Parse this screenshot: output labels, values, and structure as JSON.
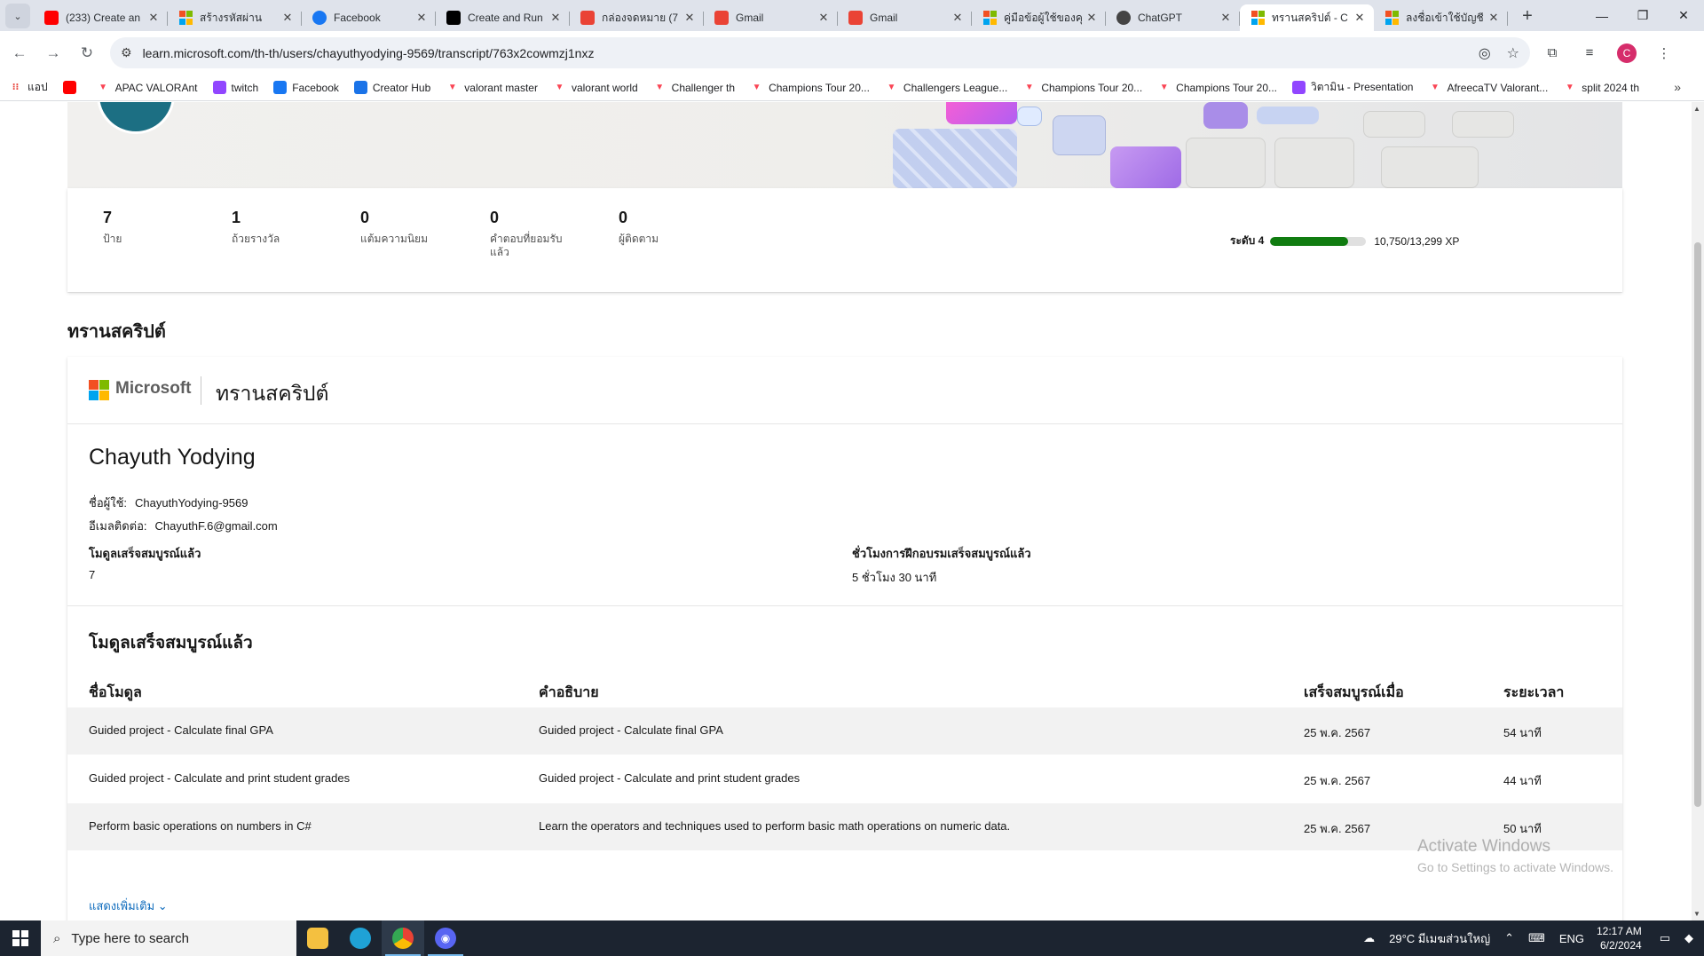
{
  "browser": {
    "tabs": [
      {
        "title": "(233) Create an",
        "icon": "youtube-icon",
        "color": "#ff0000"
      },
      {
        "title": "สร้างรหัสผ่าน",
        "icon": "microsoft-icon",
        "color": "#f25022"
      },
      {
        "title": "Facebook",
        "icon": "facebook-icon",
        "color": "#1877f2"
      },
      {
        "title": "Create and Run",
        "icon": "app-icon",
        "color": "#000000"
      },
      {
        "title": "กล่องจดหมาย (7",
        "icon": "gmail-icon",
        "color": "#ea4335"
      },
      {
        "title": "Gmail",
        "icon": "gmail-icon",
        "color": "#ea4335"
      },
      {
        "title": "Gmail",
        "icon": "gmail-icon",
        "color": "#ea4335"
      },
      {
        "title": "คู่มือข้อผู้ใช้ของคุ",
        "icon": "microsoft-icon",
        "color": "#f25022"
      },
      {
        "title": "ChatGPT",
        "icon": "chatgpt-icon",
        "color": "#444444"
      },
      {
        "title": "ทรานสคริปต์ - C",
        "icon": "microsoft-icon",
        "color": "#f25022",
        "active": true
      },
      {
        "title": "ลงชื่อเข้าใช้บัญชี",
        "icon": "microsoft-icon",
        "color": "#f25022"
      }
    ],
    "url": "learn.microsoft.com/th-th/users/chayuthyodying-9569/transcript/763x2cowmzj1nxz",
    "profile_initial": "C",
    "bookmarks": [
      {
        "label": "แอป",
        "icon": "apps-icon",
        "color": "#e8453c"
      },
      {
        "label": "",
        "icon": "youtube-icon",
        "color": "#ff0000"
      },
      {
        "label": "APAC VALORAnt",
        "icon": "valorant-icon",
        "color": "#fa4454"
      },
      {
        "label": "twitch",
        "icon": "twitch-icon",
        "color": "#9146ff"
      },
      {
        "label": "Facebook",
        "icon": "facebook-icon",
        "color": "#1877f2"
      },
      {
        "label": "Creator Hub",
        "icon": "creator-hub-icon",
        "color": "#1a73e8"
      },
      {
        "label": "valorant master",
        "icon": "valorant-icon",
        "color": "#fa4454"
      },
      {
        "label": "valorant world",
        "icon": "valorant-icon",
        "color": "#fa4454"
      },
      {
        "label": "Challenger th",
        "icon": "valorant-icon",
        "color": "#fa4454"
      },
      {
        "label": "Champions Tour 20...",
        "icon": "valorant-icon",
        "color": "#fa4454"
      },
      {
        "label": "Challengers League...",
        "icon": "valorant-icon",
        "color": "#fa4454"
      },
      {
        "label": "Champions Tour 20...",
        "icon": "valorant-icon",
        "color": "#fa4454"
      },
      {
        "label": "Champions Tour 20...",
        "icon": "valorant-icon",
        "color": "#fa4454"
      },
      {
        "label": "วิตามิน - Presentation",
        "icon": "twitch-icon",
        "color": "#9146ff"
      },
      {
        "label": "AfreecaTV Valorant...",
        "icon": "valorant-icon",
        "color": "#fa4454"
      },
      {
        "label": "split 2024 th",
        "icon": "valorant-icon",
        "color": "#fa4454"
      }
    ]
  },
  "profile": {
    "stats": [
      {
        "value": "7",
        "label": "ป้าย"
      },
      {
        "value": "1",
        "label": "ถ้วยรางวัล"
      },
      {
        "value": "0",
        "label": "แต้มความนิยม"
      },
      {
        "value": "0",
        "label": "คำตอบที่ยอมรับแล้ว"
      },
      {
        "value": "0",
        "label": "ผู้ติดตาม"
      }
    ],
    "level_label": "ระดับ 4",
    "xp_text": "10,750/13,299 XP",
    "xp_progress": 0.808
  },
  "section_title": "ทรานสคริปต์",
  "transcript": {
    "brand": "Microsoft",
    "title": "ทรานสคริปต์",
    "name": "Chayuth Yodying",
    "username_label": "ชื่อผู้ใช้:",
    "username": "ChayuthYodying-9569",
    "email_label": "อีเมลติดต่อ:",
    "email": "ChayuthF.6@gmail.com",
    "modules_completed_label": "โมดูลเสร็จสมบูรณ์แล้ว",
    "modules_completed": "7",
    "hours_label": "ชั่วโมงการฝึกอบรมเสร็จสมบูรณ์แล้ว",
    "hours": "5 ชั่วโมง 30 นาที"
  },
  "modules": {
    "title": "โมดูลเสร็จสมบูรณ์แล้ว",
    "headers": {
      "name": "ชื่อโมดูล",
      "desc": "คำอธิบาย",
      "completed": "เสร็จสมบูรณ์เมื่อ",
      "duration": "ระยะเวลา"
    },
    "rows": [
      {
        "name": "Guided project - Calculate final GPA",
        "desc": "Guided project - Calculate final GPA",
        "completed": "25 พ.ค. 2567",
        "duration": "54 นาที"
      },
      {
        "name": "Guided project - Calculate and print student grades",
        "desc": "Guided project - Calculate and print student grades",
        "completed": "25 พ.ค. 2567",
        "duration": "44 นาที"
      },
      {
        "name": "Perform basic operations on numbers in C#",
        "desc": "Learn the operators and techniques used to perform basic math operations on numeric data.",
        "completed": "25 พ.ค. 2567",
        "duration": "50 นาที"
      }
    ],
    "show_more": "แสดงเพิ่มเติม"
  },
  "watermark": {
    "line1": "Activate Windows",
    "line2": "Go to Settings to activate Windows."
  },
  "taskbar": {
    "search_placeholder": "Type here to search",
    "weather": "29°C  มีเมฆส่วนใหญ่",
    "lang": "ENG",
    "time": "12:17 AM",
    "date": "6/2/2024"
  }
}
